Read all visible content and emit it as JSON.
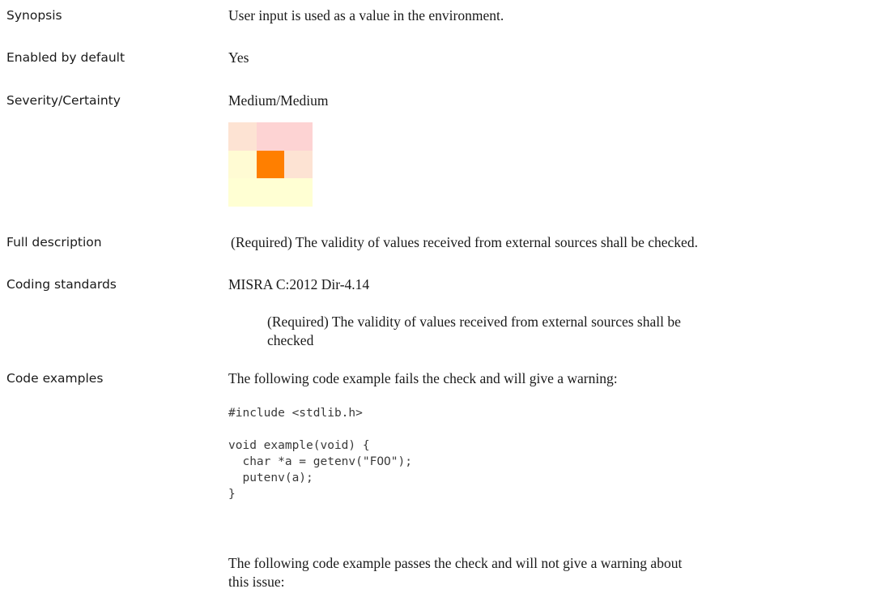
{
  "rows": {
    "synopsis": {
      "label": "Synopsis",
      "value": "User input is used as a value in the environment."
    },
    "enabled": {
      "label": "Enabled by default",
      "value": "Yes"
    },
    "severity": {
      "label": "Severity/Certainty",
      "value": "Medium/Medium"
    },
    "full_description": {
      "label": "Full description",
      "value": "(Required) The validity of values received from external sources shall be checked."
    },
    "coding_standards": {
      "label": "Coding standards",
      "standard": "MISRA C:2012 Dir-4.14",
      "detail": "(Required) The validity of values received from external sources shall be checked"
    },
    "code_examples": {
      "label": "Code examples",
      "fail_intro": "The following code example fails the check and will give a warning:",
      "code": "#include <stdlib.h>\n\nvoid example(void) {\n  char *a = getenv(\"FOO\");\n  putenv(a);\n}",
      "pass_intro": "The following code example passes the check and will not give a warning about this issue:"
    }
  },
  "severity_matrix": {
    "colors": [
      [
        "#fde3d3",
        "#fdd3d3",
        "#fdd3d3"
      ],
      [
        "#fffbd3",
        "#ff7f00",
        "#fde3d3"
      ],
      [
        "#ffffd3",
        "#ffffd3",
        "#ffffd3"
      ]
    ],
    "highlighted": {
      "row": 1,
      "col": 1
    }
  }
}
